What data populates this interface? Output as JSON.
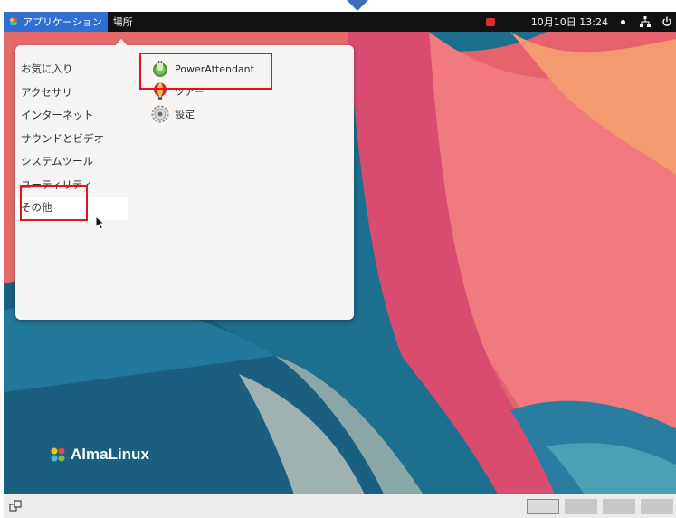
{
  "top_panel": {
    "applications_label": "アプリケーション",
    "places_label": "場所",
    "clock": "10月10日 13:24"
  },
  "menu": {
    "categories": [
      "お気に入り",
      "アクセサリ",
      "インターネット",
      "サウンドとビデオ",
      "システムツール",
      "ユーティリティ",
      "その他"
    ],
    "selected_category": "その他",
    "apps": [
      {
        "label": "PowerAttendant",
        "icon": "power-attendant-icon"
      },
      {
        "label": "ツアー",
        "icon": "tour-balloon-icon"
      },
      {
        "label": "設定",
        "icon": "settings-gear-icon"
      }
    ]
  },
  "desktop": {
    "brand": "AlmaLinux"
  },
  "workspaces": {
    "count": 4,
    "active": 1
  },
  "colors": {
    "panel": "#111111",
    "apps_highlight": "#2f6fd4",
    "annotation": "#e3131a"
  }
}
